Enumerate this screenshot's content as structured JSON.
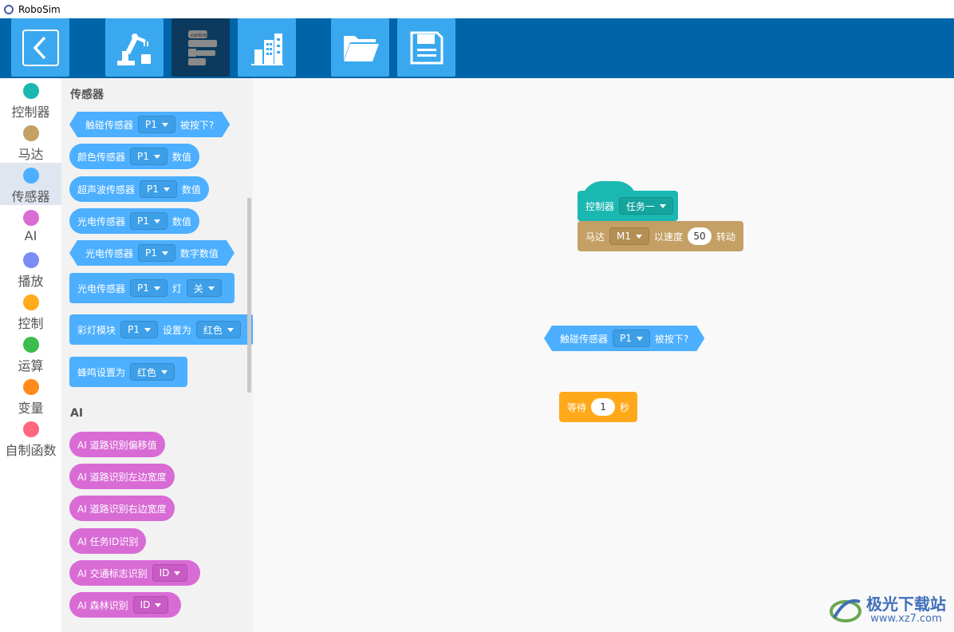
{
  "window": {
    "title": "RoboSim"
  },
  "toolbar": {
    "buttons": [
      {
        "name": "back-button",
        "icon": "chevron-left-icon"
      },
      {
        "name": "robot-arm-button",
        "icon": "robot-arm-icon"
      },
      {
        "name": "control-blocks-button",
        "icon": "control-blocks-icon",
        "badge": "control",
        "active": true
      },
      {
        "name": "buildings-button",
        "icon": "buildings-icon"
      },
      {
        "name": "open-folder-button",
        "icon": "folder-icon"
      },
      {
        "name": "save-button",
        "icon": "floppy-disk-icon"
      }
    ]
  },
  "categories": [
    {
      "label": "控制器",
      "color": "#1bb7b1"
    },
    {
      "label": "马达",
      "color": "#c4a064"
    },
    {
      "label": "传感器",
      "color": "#4cafff",
      "active": true
    },
    {
      "label": "AI",
      "color": "#d96bd5"
    },
    {
      "label": "播放",
      "color": "#7b8cf5"
    },
    {
      "label": "控制",
      "color": "#ffab1a"
    },
    {
      "label": "运算",
      "color": "#3cbc4c"
    },
    {
      "label": "变量",
      "color": "#ff8c1a"
    },
    {
      "label": "自制函数",
      "color": "#ff6680"
    }
  ],
  "palette": {
    "sensor_title": "传感器",
    "sensor_blocks": {
      "touch": {
        "t1": "触碰传感器",
        "dd": "P1",
        "t2": "被按下?"
      },
      "color": {
        "t1": "颜色传感器",
        "dd": "P1",
        "t2": "数值"
      },
      "ultrasonic": {
        "t1": "超声波传感器",
        "dd": "P1",
        "t2": "数值"
      },
      "photo": {
        "t1": "光电传感器",
        "dd": "P1",
        "t2": "数值"
      },
      "photo_digital": {
        "t1": "光电传感器",
        "dd": "P1",
        "t2": "数字数值"
      },
      "photo_light": {
        "t1": "光电传感器",
        "dd": "P1",
        "t2": "灯",
        "dd2": "关"
      },
      "led": {
        "t1": "彩灯模块",
        "dd": "P1",
        "t2": "设置为",
        "dd2": "红色"
      },
      "buzzer": {
        "t1": "蜂鸣设置为",
        "dd": "红色"
      }
    },
    "ai_title": "AI",
    "ai_blocks": {
      "road_offset": "AI 道路识别偏移值",
      "road_left": "AI 道路识别左边宽度",
      "road_right": "AI 道路识别右边宽度",
      "task_id": "AI 任务ID识别",
      "traffic": {
        "t1": "AI 交通标志识别",
        "dd": "ID"
      },
      "forest": {
        "t1": "AI 森林识别",
        "dd": "ID"
      }
    }
  },
  "workspace": {
    "controller": {
      "t1": "控制器",
      "dd": "任务一"
    },
    "motor": {
      "t1": "马达",
      "dd": "M1",
      "t2": "以速度",
      "speed": "50",
      "t3": "转动"
    },
    "touch": {
      "t1": "触碰传感器",
      "dd": "P1",
      "t2": "被按下?"
    },
    "wait": {
      "t1": "等待",
      "value": "1",
      "t2": "秒"
    }
  },
  "watermark": {
    "name": "极光下载站",
    "url": "www.xz7.com"
  }
}
